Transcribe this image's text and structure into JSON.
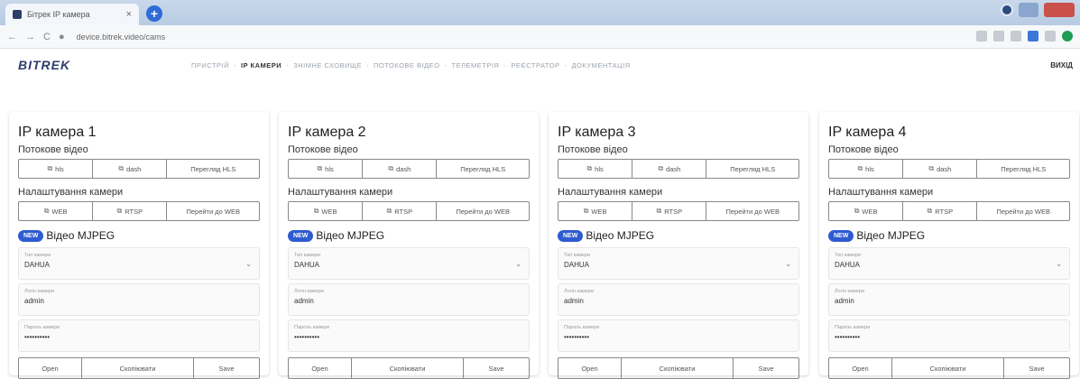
{
  "browser": {
    "tab_title": "Бітрек IP камера",
    "tab_close": "×",
    "new_tab": "+",
    "url": "device.bitrek.video/cams",
    "nav_back": "←",
    "nav_forward": "→",
    "nav_reload": "C"
  },
  "site": {
    "logo": "BITREK",
    "logout": "ВИХІД",
    "nav": [
      {
        "label": "ПРИСТРІЙ",
        "active": false
      },
      {
        "label": "IP КАМЕРИ",
        "active": true
      },
      {
        "label": "ЗНІМНЕ СХОВИЩЕ",
        "active": false
      },
      {
        "label": "ПОТОКОВЕ ВІДЕО",
        "active": false
      },
      {
        "label": "ТЕЛЕМЕТРІЯ",
        "active": false
      },
      {
        "label": "РЕЄСТРАТОР",
        "active": false
      },
      {
        "label": "ДОКУМЕНТАЦІЯ",
        "active": false
      }
    ],
    "nav_separator": "-"
  },
  "cards": [
    {
      "title": "IP камера 1",
      "stream_label": "Потокове відео",
      "stream_buttons": [
        "hls",
        "dash",
        "Перегляд HLS"
      ],
      "settings_label": "Налаштування камери",
      "settings_buttons": [
        "WEB",
        "RTSP",
        "Перейти до WEB"
      ],
      "new_badge": "NEW",
      "mjpeg_title": "Відео MJPEG",
      "type_label": "Тип камери",
      "type_value": "DAHUA",
      "login_label": "Логін камери",
      "login_value": "admin",
      "password_label": "Пароль камери",
      "password_value": "••••••••••",
      "actions": [
        "Open",
        "Скопіювати",
        "Save"
      ]
    },
    {
      "title": "IP камера 2",
      "stream_label": "Потокове відео",
      "stream_buttons": [
        "hls",
        "dash",
        "Перегляд HLS"
      ],
      "settings_label": "Налаштування камери",
      "settings_buttons": [
        "WEB",
        "RTSP",
        "Перейти до WEB"
      ],
      "new_badge": "NEW",
      "mjpeg_title": "Відео MJPEG",
      "type_label": "Тип камери",
      "type_value": "DAHUA",
      "login_label": "Логін камери",
      "login_value": "admin",
      "password_label": "Пароль камери",
      "password_value": "••••••••••",
      "actions": [
        "Open",
        "Скопіювати",
        "Save"
      ]
    },
    {
      "title": "IP камера 3",
      "stream_label": "Потокове відео",
      "stream_buttons": [
        "hls",
        "dash",
        "Перегляд HLS"
      ],
      "settings_label": "Налаштування камери",
      "settings_buttons": [
        "WEB",
        "RTSP",
        "Перейти до WEB"
      ],
      "new_badge": "NEW",
      "mjpeg_title": "Відео MJPEG",
      "type_label": "Тип камери",
      "type_value": "DAHUA",
      "login_label": "Логін камери",
      "login_value": "admin",
      "password_label": "Пароль камери",
      "password_value": "••••••••••",
      "actions": [
        "Open",
        "Скопіювати",
        "Save"
      ]
    },
    {
      "title": "IP камера 4",
      "stream_label": "Потокове відео",
      "stream_buttons": [
        "hls",
        "dash",
        "Перегляд HLS"
      ],
      "settings_label": "Налаштування камери",
      "settings_buttons": [
        "WEB",
        "RTSP",
        "Перейти до WEB"
      ],
      "new_badge": "NEW",
      "mjpeg_title": "Відео MJPEG",
      "type_label": "Тип камери",
      "type_value": "DAHUA",
      "login_label": "Логін камери",
      "login_value": "admin",
      "password_label": "Пароль камери",
      "password_value": "••••••••••",
      "actions": [
        "Open",
        "Скопіювати",
        "Save"
      ]
    }
  ],
  "icons": {
    "link_icon": "⧉",
    "chevron": "⌄"
  },
  "colors": {
    "new_badge": "#2f5bd0",
    "logo": "#2c3e6b"
  }
}
